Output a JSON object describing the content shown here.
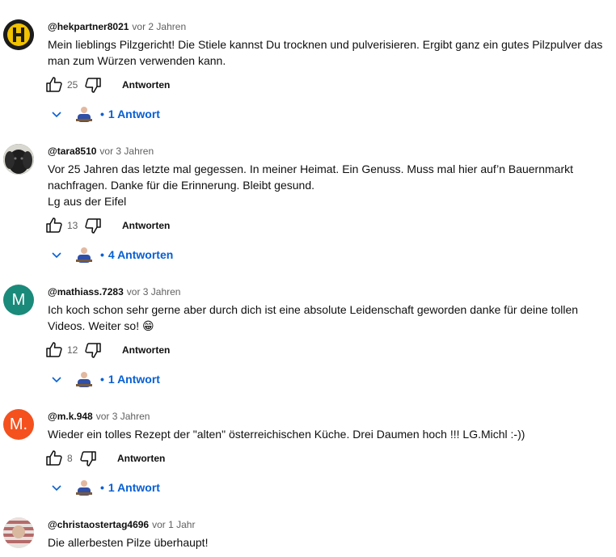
{
  "colors": {
    "link_blue": "#065fd4",
    "meta_gray": "#606060"
  },
  "icons": {
    "like": "thumb-up-icon",
    "dislike": "thumb-down-icon",
    "expand": "chevron-down-icon"
  },
  "comments": [
    {
      "handle": "@hekpartner8021",
      "time": "vor 2 Jahren",
      "lines": [
        "Mein lieblings Pilzgericht! Die Stiele kannst Du trocknen und pulverisieren. Ergibt ganz ein gutes Pilzpulver das",
        "man zum Würzen verwenden kann."
      ],
      "likes": "25",
      "reply_label": "Antworten",
      "replies_label": "1 Antwort"
    },
    {
      "handle": "@tara8510",
      "time": "vor 3 Jahren",
      "lines": [
        "Vor 25 Jahren das letzte mal gegessen. In meiner Heimat. Ein Genuss. Muss mal hier auf’n Bauernmarkt",
        "nachfragen. Danke für die Erinnerung. Bleibt gesund.",
        "Lg aus der Eifel"
      ],
      "likes": "13",
      "reply_label": "Antworten",
      "replies_label": "4 Antworten"
    },
    {
      "handle": "@mathiass.7283",
      "time": "vor 3 Jahren",
      "avatar_letter": "M",
      "avatar_color": "#1a8a7a",
      "lines": [
        "Ich koch schon sehr gerne aber durch dich ist eine absolute Leidenschaft geworden danke für deine tollen",
        "Videos. Weiter so! 😁"
      ],
      "likes": "12",
      "reply_label": "Antworten",
      "replies_label": "1 Antwort"
    },
    {
      "handle": "@m.k.948",
      "time": "vor 3 Jahren",
      "avatar_letter": "M.",
      "avatar_color": "#f4511e",
      "lines": [
        "Wieder ein tolles Rezept der \"alten\" österreichischen Küche. Drei Daumen hoch !!! LG.Michl :-))"
      ],
      "likes": "8",
      "reply_label": "Antworten",
      "replies_label": "1 Antwort"
    },
    {
      "handle": "@christaostertag4696",
      "time": "vor 1 Jahr",
      "lines": [
        "Die allerbesten Pilze überhaupt!"
      ]
    }
  ]
}
